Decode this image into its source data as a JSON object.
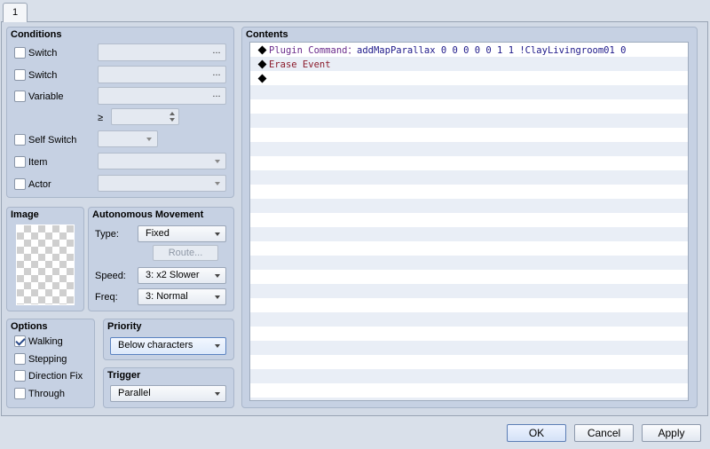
{
  "tab": {
    "label": "1"
  },
  "conditions": {
    "title": "Conditions",
    "switch1": {
      "label": "Switch",
      "dots": "..."
    },
    "switch2": {
      "label": "Switch",
      "dots": "..."
    },
    "variable": {
      "label": "Variable",
      "dots": "..."
    },
    "ge_symbol": "≥",
    "self_switch": {
      "label": "Self Switch"
    },
    "item": {
      "label": "Item"
    },
    "actor": {
      "label": "Actor"
    }
  },
  "image": {
    "title": "Image"
  },
  "autonomous": {
    "title": "Autonomous Movement",
    "type_label": "Type:",
    "type_value": "Fixed",
    "route_label": "Route...",
    "speed_label": "Speed:",
    "speed_value": "3: x2 Slower",
    "freq_label": "Freq:",
    "freq_value": "3: Normal"
  },
  "options": {
    "title": "Options",
    "walking": {
      "label": "Walking",
      "checked": true
    },
    "stepping": {
      "label": "Stepping",
      "checked": false
    },
    "direction_fix": {
      "label": "Direction Fix",
      "checked": false
    },
    "through": {
      "label": "Through",
      "checked": false
    }
  },
  "priority": {
    "title": "Priority",
    "value": "Below characters"
  },
  "trigger": {
    "title": "Trigger",
    "value": "Parallel"
  },
  "contents": {
    "title": "Contents",
    "commands": [
      {
        "name": "Plugin Command",
        "separator": "：",
        "args": "addMapParallax 0 0 0 0 0 1 1 !ClayLivingroom01 0"
      },
      {
        "name": "Erase Event"
      },
      {
        "name": ""
      }
    ]
  },
  "buttons": {
    "ok": "OK",
    "cancel": "Cancel",
    "apply": "Apply"
  },
  "colors": {
    "accent": "#5c7eb5",
    "panel": "#c6d1e3"
  }
}
